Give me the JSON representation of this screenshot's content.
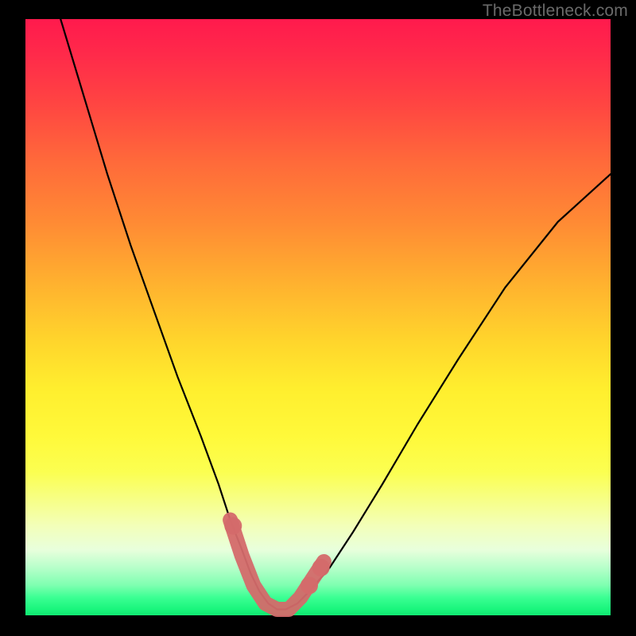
{
  "watermark": "TheBottleneck.com",
  "colors": {
    "curve": "#000000",
    "highlight": "#d46a6a",
    "gradient_top": "#ff1a4d",
    "gradient_bottom": "#12e872",
    "frame": "#000000"
  },
  "chart_data": {
    "type": "line",
    "title": "",
    "xlabel": "",
    "ylabel": "",
    "xlim": [
      0,
      100
    ],
    "ylim": [
      0,
      100
    ],
    "grid": false,
    "legend": false,
    "series": [
      {
        "name": "bottleneck-curve",
        "x": [
          6,
          10,
          14,
          18,
          22,
          26,
          30,
          33,
          35,
          37,
          38.5,
          40,
          41.5,
          43,
          44.5,
          46.5,
          48.5,
          52,
          56,
          61,
          67,
          74,
          82,
          91,
          100
        ],
        "y": [
          100,
          87,
          74,
          62,
          51,
          40,
          30,
          22,
          16,
          11,
          7,
          4,
          2,
          1,
          1,
          2,
          4,
          8,
          14,
          22,
          32,
          43,
          55,
          66,
          74
        ]
      }
    ],
    "highlight_segment": {
      "name": "optimal-range",
      "x": [
        35,
        37,
        39,
        41,
        43,
        45,
        47,
        49,
        51
      ],
      "y": [
        16,
        10,
        5,
        2,
        1,
        1,
        3,
        6,
        9
      ]
    },
    "highlight_dots": {
      "x": [
        35.5,
        48.5,
        50.5
      ],
      "y": [
        15,
        5,
        8
      ]
    }
  }
}
